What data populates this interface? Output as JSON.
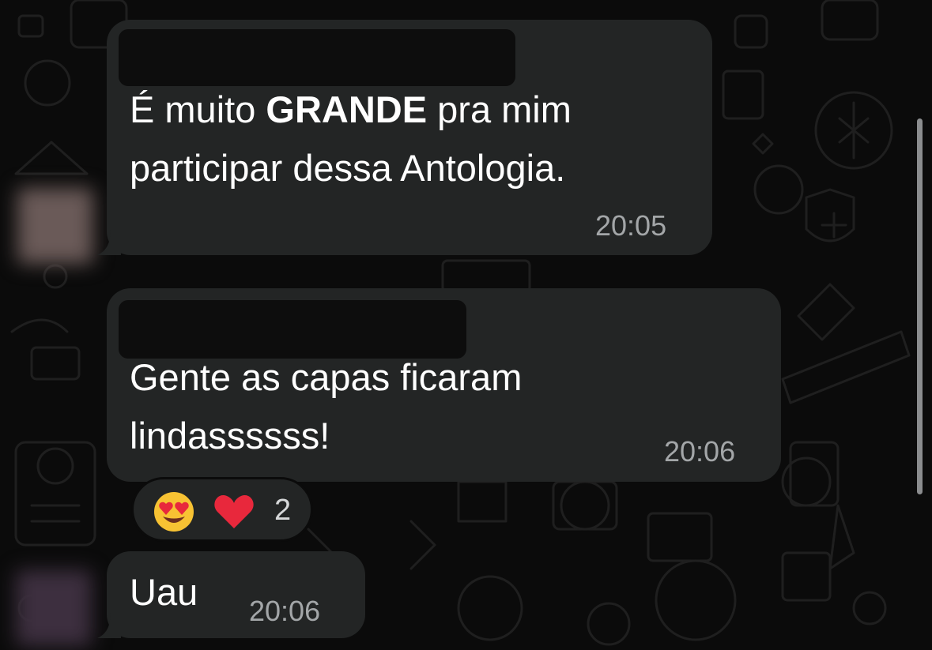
{
  "messages": [
    {
      "sender_name": "",
      "text_before": "É muito ",
      "text_bold": "GRANDE",
      "text_after": " pra mim",
      "line2": "participar dessa Antologia.",
      "time": "20:05"
    },
    {
      "sender_name": "",
      "line1": "Gente as capas ficaram",
      "line2": "lindassssss!",
      "time": "20:06",
      "reactions": {
        "emojis": [
          "heart-eyes-emoji",
          "red-heart-emoji"
        ],
        "count": "2"
      }
    },
    {
      "text": "Uau",
      "time": "20:06"
    }
  ],
  "colors": {
    "background": "#0b0b0b",
    "bubble": "#232525",
    "timestamp": "#a3a6a8",
    "text": "#ffffff"
  }
}
